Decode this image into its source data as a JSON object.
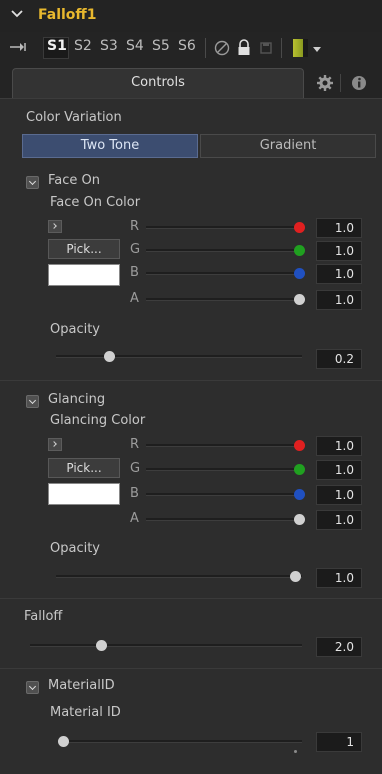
{
  "header": {
    "title": "Falloff1"
  },
  "toolbar": {
    "versions": [
      "S1",
      "S2",
      "S3",
      "S4",
      "S5",
      "S6"
    ],
    "active_version": "S1"
  },
  "tabs": {
    "controls_label": "Controls"
  },
  "color_variation": {
    "label": "Color Variation",
    "options": [
      "Two Tone",
      "Gradient"
    ],
    "selected": "Two Tone"
  },
  "face_on": {
    "checkbox_label": "Face On",
    "color_label": "Face On Color",
    "pick_label": "Pick...",
    "swatch_color": "#ffffff",
    "channels": [
      {
        "name": "R",
        "value": "1.0",
        "color": "#e02020"
      },
      {
        "name": "G",
        "value": "1.0",
        "color": "#20a020"
      },
      {
        "name": "B",
        "value": "1.0",
        "color": "#2050c0"
      },
      {
        "name": "A",
        "value": "1.0",
        "color": "#d0d0d0"
      }
    ],
    "opacity_label": "Opacity",
    "opacity_value": "0.2"
  },
  "glancing": {
    "checkbox_label": "Glancing",
    "color_label": "Glancing Color",
    "pick_label": "Pick...",
    "swatch_color": "#ffffff",
    "channels": [
      {
        "name": "R",
        "value": "1.0",
        "color": "#e02020"
      },
      {
        "name": "G",
        "value": "1.0",
        "color": "#20a020"
      },
      {
        "name": "B",
        "value": "1.0",
        "color": "#2050c0"
      },
      {
        "name": "A",
        "value": "1.0",
        "color": "#d0d0d0"
      }
    ],
    "opacity_label": "Opacity",
    "opacity_value": "1.0"
  },
  "falloff": {
    "label": "Falloff",
    "value": "2.0"
  },
  "material": {
    "checkbox_label": "MaterialID",
    "label": "Material ID",
    "value": "1"
  },
  "colors": {
    "accent": "#e8b82e",
    "selected_button": "#3c4d70"
  }
}
